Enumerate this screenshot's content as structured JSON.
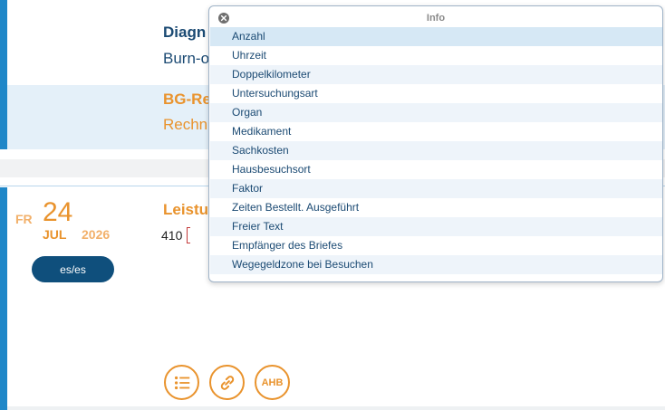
{
  "diagnose": {
    "title": "Diagn",
    "value": "Burn-o"
  },
  "bg": {
    "title": "BG-Re",
    "value": "Rechn"
  },
  "date": {
    "weekday": "FR",
    "day": "24",
    "month": "JUL",
    "year": "2026"
  },
  "user_badge": "es/es",
  "leistung": {
    "title": "Leistu",
    "input_value": "410"
  },
  "actions": {
    "ahb_label": "AHB"
  },
  "popup": {
    "title": "Info",
    "items": [
      "Anzahl",
      "Uhrzeit",
      "Doppelkilometer",
      "Untersuchungsart",
      "Organ",
      "Medikament",
      "Sachkosten",
      "Hausbesuchsort",
      "Faktor",
      "Zeiten Bestellt. Ausgeführt",
      "Freier Text",
      "Empfänger des Briefes",
      "Wegegeldzone bei Besuchen"
    ],
    "selected_index": 0
  },
  "colors": {
    "accent_blue": "#1f87c8",
    "navy": "#1b4a73",
    "orange": "#e9932d",
    "badge": "#0f4f7c"
  }
}
